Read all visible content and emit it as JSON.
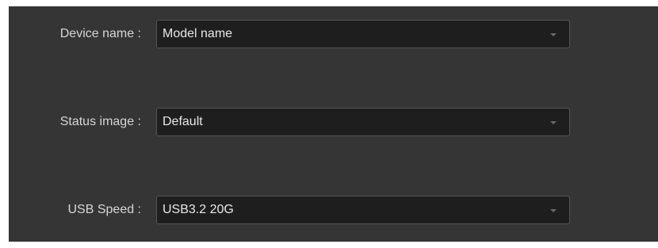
{
  "settings": {
    "rows": [
      {
        "label": "Device name :",
        "value": "Model name"
      },
      {
        "label": "Status image :",
        "value": "Default"
      },
      {
        "label": "USB Speed :",
        "value": "USB3.2 20G"
      }
    ]
  },
  "icons": {
    "dropdown": "chevron-down-icon"
  },
  "colors": {
    "panel_bg": "#353535",
    "field_bg": "#1e1e1e",
    "field_border": "#555555",
    "label_text": "#d6d6d6",
    "value_text": "#e8e8e8",
    "arrow": "#6a6a6a"
  }
}
